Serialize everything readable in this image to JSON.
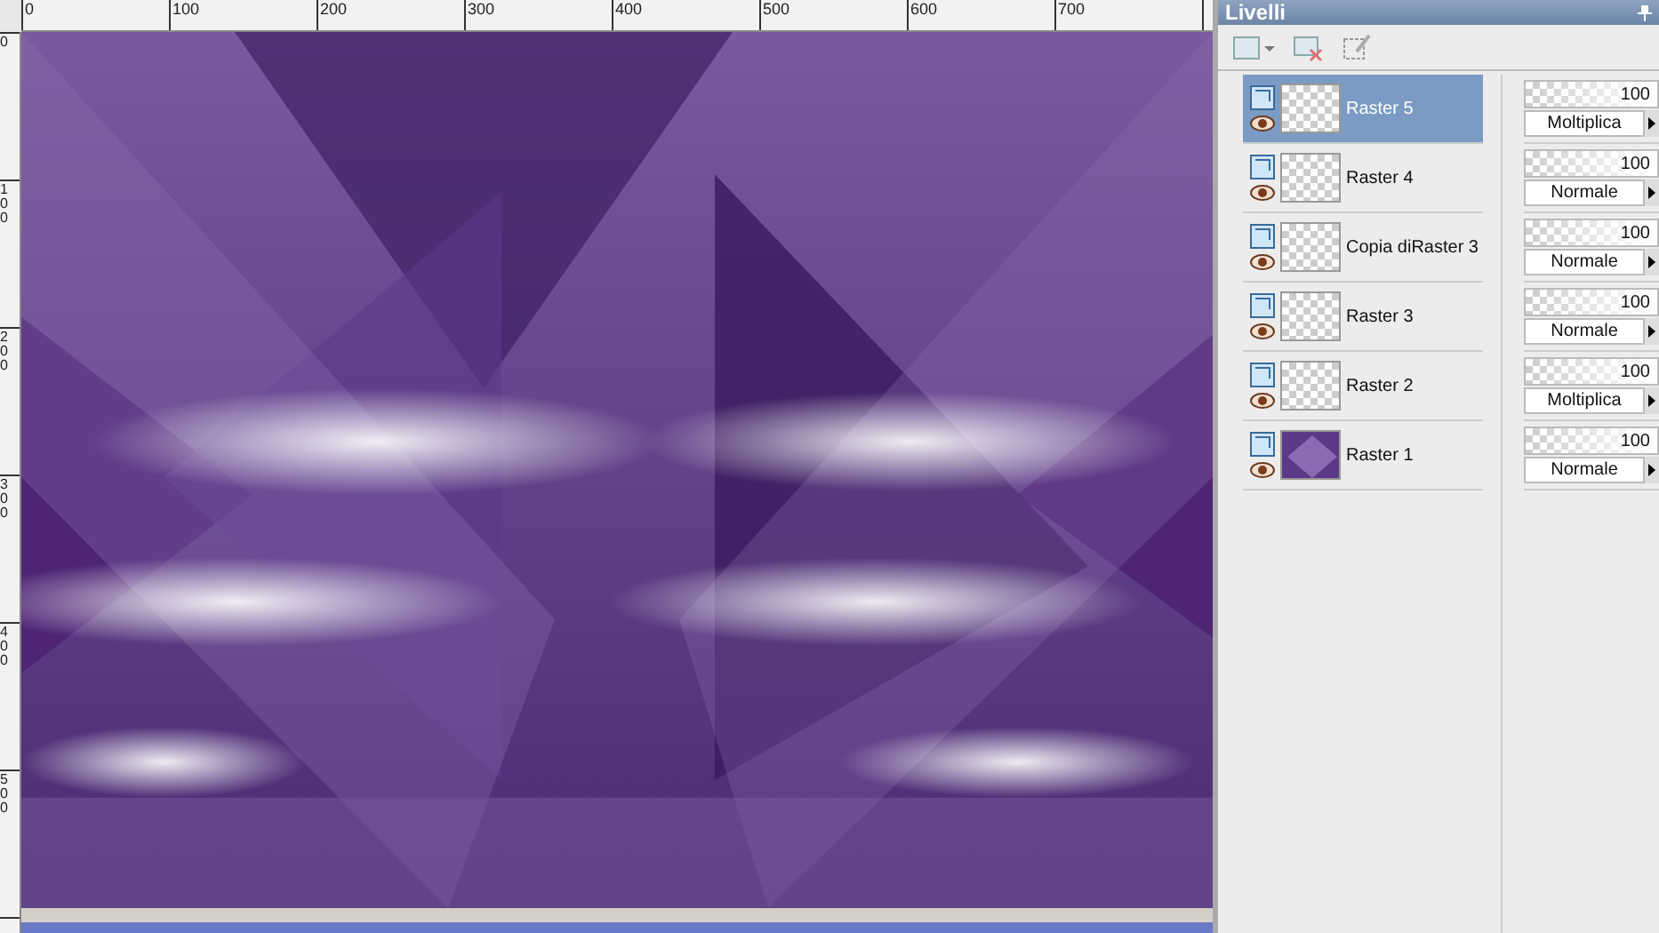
{
  "ruler_top": {
    "labels": [
      "0",
      "100",
      "200",
      "300",
      "400",
      "500",
      "600",
      "700"
    ]
  },
  "ruler_left": {
    "labels": [
      "0",
      "100",
      "200",
      "300",
      "400",
      "500"
    ]
  },
  "panel": {
    "title": "Livelli",
    "layers": [
      {
        "name": "Raster 5",
        "selected": true,
        "kind": "transparent",
        "level": 1,
        "opacity": "100",
        "blend": "Moltiplica"
      },
      {
        "name": "Raster 4",
        "selected": false,
        "kind": "transparent",
        "level": 1,
        "opacity": "100",
        "blend": "Normale"
      },
      {
        "name": "Copia diRaster 3",
        "selected": false,
        "kind": "transparent",
        "level": 1,
        "opacity": "100",
        "blend": "Normale"
      },
      {
        "name": "Raster 3",
        "selected": false,
        "kind": "transparent",
        "level": 1,
        "opacity": "100",
        "blend": "Normale"
      },
      {
        "name": "Raster 2",
        "selected": false,
        "kind": "transparent",
        "level": 1,
        "opacity": "100",
        "blend": "Moltiplica"
      },
      {
        "name": "Raster 1",
        "selected": false,
        "kind": "filled",
        "level": 1,
        "opacity": "100",
        "blend": "Normale"
      }
    ]
  }
}
